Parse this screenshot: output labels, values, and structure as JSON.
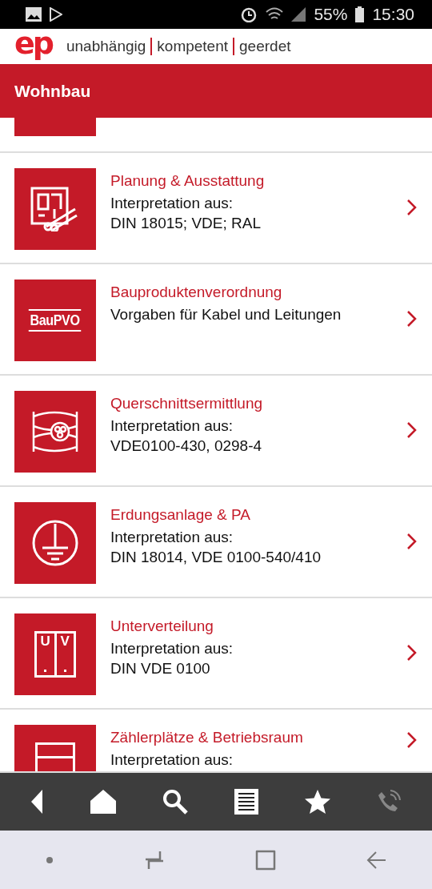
{
  "status_bar": {
    "battery": "55%",
    "time": "15:30"
  },
  "header": {
    "logo": "ep",
    "slogan": [
      "unabhängig",
      "kompetent",
      "geerdet"
    ]
  },
  "title_bar": {
    "title": "Wohnbau"
  },
  "items": [
    {
      "kind": "plan",
      "title": "Planung & Ausstattung",
      "lines": [
        "Interpretation aus:",
        "DIN 18015; VDE; RAL"
      ]
    },
    {
      "kind": "baupvo",
      "icon_text": [
        "BauPVO"
      ],
      "title": "Bauproduktenverordnung",
      "lines": [
        "Vorgaben für Kabel und Leitungen"
      ]
    },
    {
      "kind": "cable",
      "title": "Querschnittsermittlung",
      "lines": [
        "Interpretation aus:",
        "VDE0100-430, 0298-4"
      ]
    },
    {
      "kind": "earth",
      "title": "Erdungsanlage & PA",
      "lines": [
        "Interpretation aus:",
        "DIN 18014, VDE 0100-540/410"
      ]
    },
    {
      "kind": "cabinet",
      "icon_text": [
        "U",
        "V"
      ],
      "title": "Unterverteilung",
      "lines": [
        "Interpretation aus:",
        "DIN VDE 0100"
      ]
    },
    {
      "kind": "meter",
      "title": "Zählerplätze & Betriebsraum",
      "lines": [
        "Interpretation aus:"
      ]
    }
  ],
  "toolbar": [
    {
      "kind": "back",
      "disabled": false
    },
    {
      "kind": "home",
      "disabled": false
    },
    {
      "kind": "search",
      "disabled": false
    },
    {
      "kind": "list",
      "disabled": false
    },
    {
      "kind": "favorites",
      "disabled": false
    },
    {
      "kind": "call",
      "disabled": true
    }
  ]
}
